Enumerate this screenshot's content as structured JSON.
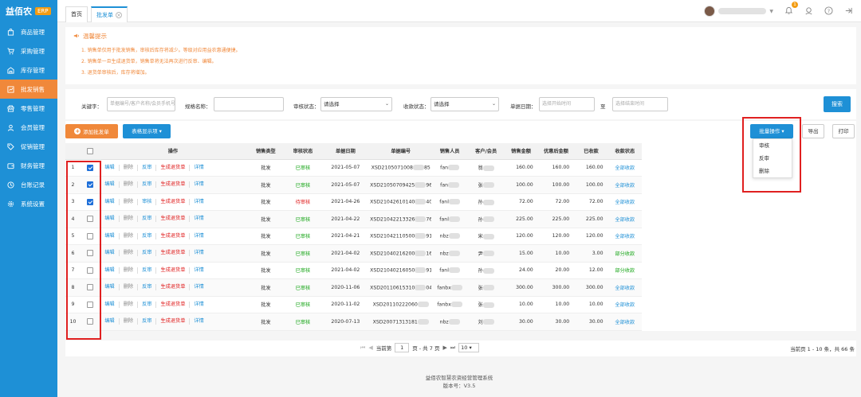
{
  "brand": {
    "name": "益佰农",
    "badge": "ERP"
  },
  "sidebar": {
    "items": [
      {
        "label": "商品管理",
        "icon": "bag-icon"
      },
      {
        "label": "采购管理",
        "icon": "cart-icon"
      },
      {
        "label": "库存管理",
        "icon": "warehouse-icon"
      },
      {
        "label": "批发销售",
        "icon": "sales-icon",
        "active": true
      },
      {
        "label": "零售管理",
        "icon": "store-icon"
      },
      {
        "label": "会员管理",
        "icon": "user-icon"
      },
      {
        "label": "促销管理",
        "icon": "tag-icon"
      },
      {
        "label": "财务管理",
        "icon": "finance-icon"
      },
      {
        "label": "台账记录",
        "icon": "record-icon"
      },
      {
        "label": "系统设置",
        "icon": "gear-icon"
      }
    ]
  },
  "tabs": [
    {
      "label": "首页"
    },
    {
      "label": "批发单",
      "active": true
    }
  ],
  "topbar": {
    "notification_count": "1"
  },
  "tips": {
    "title": "温馨提示",
    "lines": [
      "1. 销售单仅用于批发销售，审核后库存将减少。等级对应用益农惠通便捷。",
      "2. 销售单一旦生成退货单，销售单将无法再次进行反审、编辑。",
      "3. 退货单审核后，库存将增加。"
    ]
  },
  "search": {
    "keyword_label": "关键字：",
    "keyword_placeholder": "单据编号/客户名称/会员手机号",
    "spec_label": "规格名称：",
    "audit_label": "审核状态：",
    "audit_value": "请选择",
    "pay_label": "收款状态：",
    "pay_value": "请选择",
    "date_label": "单据日期：",
    "date_start_placeholder": "选择开始时间",
    "date_sep": "至",
    "date_end_placeholder": "选择结束时间",
    "search_button": "搜索"
  },
  "toolbar": {
    "add_button": "添加批发单",
    "columns_button": "表格显示项",
    "batch_button": "批量操作",
    "export_button": "导出",
    "print_button": "打印",
    "batch_menu": [
      "审核",
      "反审",
      "删除"
    ]
  },
  "table": {
    "headers": [
      "",
      "",
      "操作",
      "销售类型",
      "审核状态",
      "单据日期",
      "单据编号",
      "销售人员",
      "客户/会员",
      "销售金额",
      "优惠后金额",
      "已收款",
      "收款状态"
    ],
    "op_labels": {
      "edit": "编辑",
      "delete": "删除",
      "audit": "审核",
      "reverse": "反审",
      "return": "生成退货单",
      "detail": "详情"
    },
    "rows": [
      {
        "idx": "1",
        "checked": true,
        "audited": true,
        "type": "批发",
        "status": "已审核",
        "date": "2021-05-07",
        "code": "XSD2105071008",
        "code_tail": "85",
        "seller": "fan",
        "customer": "翁",
        "amount": "160.00",
        "discounted": "160.00",
        "received": "160.00",
        "pay_status": "全部收款"
      },
      {
        "idx": "2",
        "checked": true,
        "audited": true,
        "type": "批发",
        "status": "已审核",
        "date": "2021-05-07",
        "code": "XSD21050709425",
        "code_tail": "96",
        "seller": "fan",
        "customer": "张",
        "amount": "100.00",
        "discounted": "100.00",
        "received": "100.00",
        "pay_status": "全部收款"
      },
      {
        "idx": "3",
        "checked": true,
        "audited": false,
        "type": "批发",
        "status": "待审核",
        "date": "2021-04-26",
        "code": "XSD21042610140",
        "code_tail": "40",
        "seller": "fanl",
        "customer": "孙",
        "amount": "72.00",
        "discounted": "72.00",
        "received": "72.00",
        "pay_status": "全部收款"
      },
      {
        "idx": "4",
        "checked": false,
        "audited": true,
        "type": "批发",
        "status": "已审核",
        "date": "2021-04-22",
        "code": "XSD21042213326",
        "code_tail": "76",
        "seller": "fanl",
        "customer": "孙",
        "amount": "225.00",
        "discounted": "225.00",
        "received": "225.00",
        "pay_status": "全部收款"
      },
      {
        "idx": "5",
        "checked": false,
        "audited": true,
        "type": "批发",
        "status": "已审核",
        "date": "2021-04-21",
        "code": "XSD21042110500",
        "code_tail": "91",
        "seller": "nbz",
        "customer": "宋",
        "amount": "120.00",
        "discounted": "120.00",
        "received": "120.00",
        "pay_status": "全部收款"
      },
      {
        "idx": "6",
        "checked": false,
        "audited": true,
        "type": "批发",
        "status": "已审核",
        "date": "2021-04-02",
        "code": "XSD21040216200",
        "code_tail": "16",
        "seller": "nbz",
        "customer": "尹",
        "amount": "15.00",
        "discounted": "10.00",
        "received": "3.00",
        "pay_status": "部分收款"
      },
      {
        "idx": "7",
        "checked": false,
        "audited": true,
        "type": "批发",
        "status": "已审核",
        "date": "2021-04-02",
        "code": "XSD21040216050",
        "code_tail": "91",
        "seller": "fanl",
        "customer": "孙",
        "amount": "24.00",
        "discounted": "20.00",
        "received": "12.00",
        "pay_status": "部分收款"
      },
      {
        "idx": "8",
        "checked": false,
        "audited": true,
        "type": "批发",
        "status": "已审核",
        "date": "2020-11-06",
        "code": "XSD20110615310",
        "code_tail": "04",
        "seller": "fanbx",
        "customer": "张",
        "amount": "300.00",
        "discounted": "300.00",
        "received": "300.00",
        "pay_status": "全部收款"
      },
      {
        "idx": "9",
        "checked": false,
        "audited": true,
        "type": "批发",
        "status": "已审核",
        "date": "2020-11-02",
        "code": "XSD20110222060",
        "code_tail": "",
        "seller": "fanbx",
        "customer": "张",
        "amount": "10.00",
        "discounted": "10.00",
        "received": "10.00",
        "pay_status": "全部收款"
      },
      {
        "idx": "10",
        "checked": false,
        "audited": true,
        "type": "批发",
        "status": "已审核",
        "date": "2020-07-13",
        "code": "XSD20071313181",
        "code_tail": "",
        "seller": "nbz",
        "customer": "刘",
        "amount": "30.00",
        "discounted": "30.00",
        "received": "30.00",
        "pay_status": "全部收款"
      }
    ]
  },
  "pager": {
    "current_label": "当前第",
    "current_page": "1",
    "total_label": "页 - 共 7 页",
    "page_size": "10",
    "summary": "当前页 1 - 10 条，共 66 条"
  },
  "footer": {
    "line1": "益佰农智慧农资经营管理系统",
    "line2": "版本号：V3.5"
  },
  "colors": {
    "primary": "#1e90d6",
    "accent": "#f0883a",
    "highlight": "#e02020",
    "success": "#19a619"
  }
}
